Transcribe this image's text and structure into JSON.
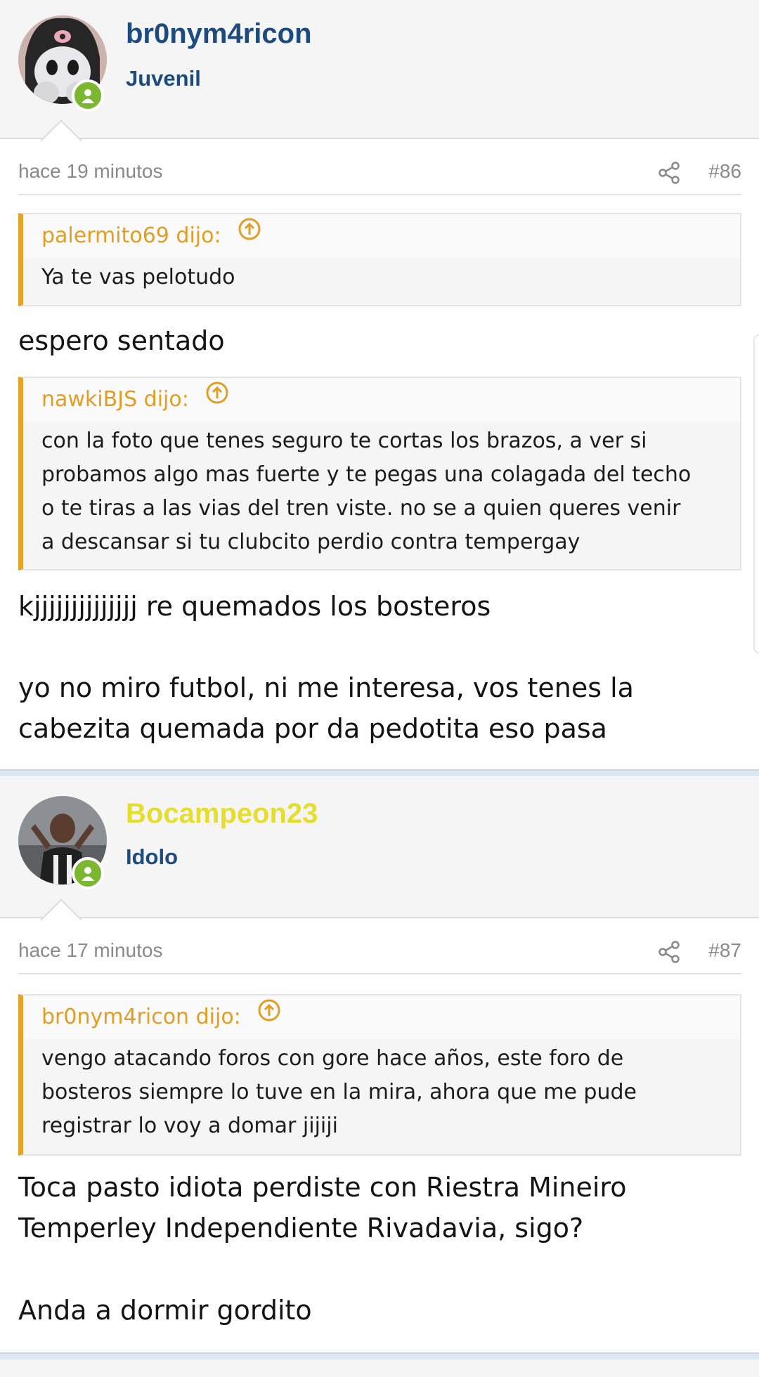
{
  "posts": [
    {
      "username": "br0nym4ricon",
      "user_title": "Juvenil",
      "username_color": "#1d4b7e",
      "time": "hace 19 minutos",
      "number": "#86",
      "quotes": [
        {
          "author": "palermito69 dijo:",
          "lines": [
            "Ya te vas pelotudo"
          ]
        },
        {
          "author": "nawkiBJS dijo:",
          "lines": [
            "con la foto que tenes seguro te cortas los brazos, a ver si",
            "probamos algo mas fuerte y te pegas una colagada del techo",
            "o te tiras a las vias del tren viste. no se a quien queres venir",
            "a descansar si tu clubcito perdio contra tempergay"
          ]
        }
      ],
      "texts": [
        "espero sentado",
        "kjjjjjjjjjjjjjj re quemados los bosteros",
        "yo no miro futbol, ni me interesa, vos tenes la",
        "cabezita quemada por da pedotita eso pasa"
      ]
    },
    {
      "username": "Bocampeon23",
      "user_title": "Idolo",
      "username_color": "#e6de2e",
      "time": "hace 17 minutos",
      "number": "#87",
      "quotes": [
        {
          "author": "br0nym4ricon dijo:",
          "lines": [
            "vengo atacando foros con gore hace años, este foro de",
            "bosteros siempre lo tuve en la mira, ahora que me pude",
            "registrar lo voy a domar jijiji"
          ]
        }
      ],
      "texts": [
        "Toca pasto idiota perdiste con Riestra Mineiro",
        "Temperley Independiente Rivadavia, sigo?",
        "Anda a dormir gordito"
      ]
    }
  ],
  "icons": {
    "share": "share-icon",
    "quote_jump": "arrow-up-circle-icon",
    "online": "online-user-icon"
  }
}
